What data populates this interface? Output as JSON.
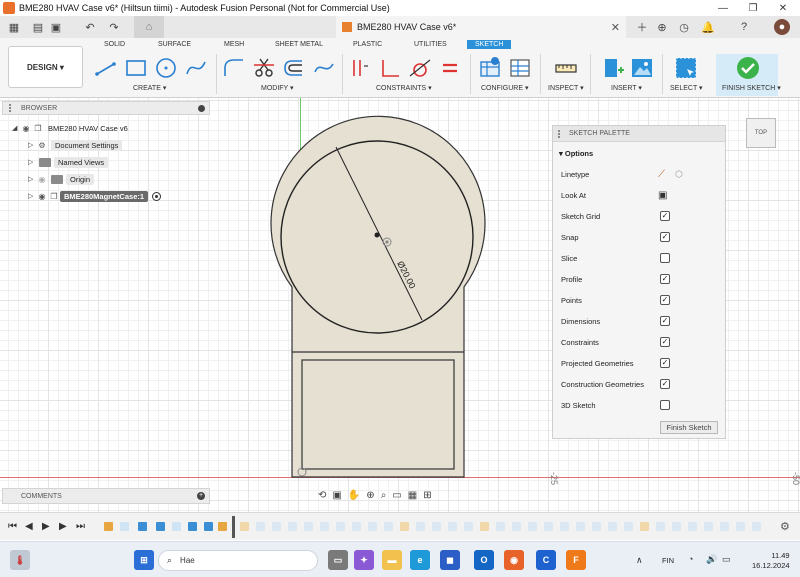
{
  "window": {
    "title": "BME280 HVAV Case v6* (Hiltsun tiimi) - Autodesk Fusion Personal (Not for Commercial Use)"
  },
  "tabbar": {
    "doc_tab": "BME280 HVAV Case v6*"
  },
  "ribbon": {
    "design_label": "DESIGN ▾",
    "tabs": [
      "SOLID",
      "SURFACE",
      "MESH",
      "SHEET METAL",
      "PLASTIC",
      "UTILITIES",
      "SKETCH"
    ],
    "active_tab": "SKETCH",
    "groups": [
      "CREATE ▾",
      "MODIFY ▾",
      "CONSTRAINTS ▾",
      "CONFIGURE ▾",
      "INSPECT ▾",
      "INSERT ▾",
      "SELECT ▾",
      "FINISH SKETCH ▾"
    ]
  },
  "browser": {
    "title": "BROWSER",
    "root": "BME280 HVAV Case v6",
    "items": [
      {
        "label": "Document Settings"
      },
      {
        "label": "Named Views"
      },
      {
        "label": "Origin"
      },
      {
        "label": "BME280MagnetCase:1"
      }
    ]
  },
  "comments": {
    "title": "COMMENTS"
  },
  "palette": {
    "title": "SKETCH PALETTE",
    "section": "Options",
    "rows": [
      {
        "label": "Linetype",
        "kind": "icon"
      },
      {
        "label": "Look At",
        "kind": "icon"
      },
      {
        "label": "Sketch Grid",
        "checked": true
      },
      {
        "label": "Snap",
        "checked": true
      },
      {
        "label": "Slice",
        "checked": false
      },
      {
        "label": "Profile",
        "checked": true
      },
      {
        "label": "Points",
        "checked": true
      },
      {
        "label": "Dimensions",
        "checked": true
      },
      {
        "label": "Constraints",
        "checked": true
      },
      {
        "label": "Projected Geometries",
        "checked": true
      },
      {
        "label": "Construction Geometries",
        "checked": true
      },
      {
        "label": "3D Sketch",
        "checked": false
      }
    ],
    "finish_button": "Finish Sketch"
  },
  "viewcube": {
    "face": "TOP"
  },
  "sketch": {
    "dimension_label": "Ø20.00",
    "ruler_labels": [
      "-25",
      "-50"
    ]
  },
  "taskbar": {
    "search_placeholder": "Hae",
    "language": "FIN",
    "time": "11.49",
    "date": "16.12.2024"
  },
  "colors": {
    "accent": "#2b92d9",
    "finish_green": "#3cb34a",
    "part_fill": "#e6e0d2",
    "axis_green": "#6cc86c",
    "axis_red": "#e07070"
  }
}
